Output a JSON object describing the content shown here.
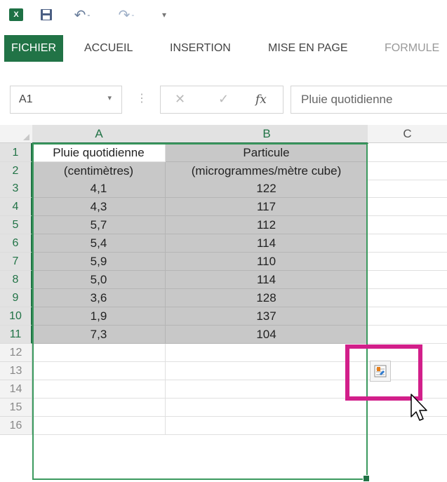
{
  "app": {
    "icon": "excel-icon"
  },
  "quick_access": {
    "save": "save-icon",
    "undo": "↶",
    "redo": "↷",
    "more": "▾",
    "dropdown_arrows": "-"
  },
  "ribbon": {
    "tabs": [
      {
        "label": "FICHIER",
        "active": true
      },
      {
        "label": "ACCUEIL"
      },
      {
        "label": "INSERTION"
      },
      {
        "label": "MISE EN PAGE"
      },
      {
        "label": "FORMULE"
      }
    ]
  },
  "formula_bar": {
    "name_box": "A1",
    "name_arrow": "▾",
    "separator": "⋮",
    "cancel": "✕",
    "enter": "✓",
    "fx": "fx",
    "value": "Pluie quotidienne"
  },
  "grid": {
    "columns": [
      "A",
      "B",
      "C"
    ],
    "rows": [
      {
        "num": "1",
        "a": "Pluie quotidienne",
        "b": "Particule"
      },
      {
        "num": "2",
        "a": "(centimètres)",
        "b": "(microgrammes/mètre cube)"
      },
      {
        "num": "3",
        "a": "4,1",
        "b": "122"
      },
      {
        "num": "4",
        "a": "4,3",
        "b": "117"
      },
      {
        "num": "5",
        "a": "5,7",
        "b": "112"
      },
      {
        "num": "6",
        "a": "5,4",
        "b": "114"
      },
      {
        "num": "7",
        "a": "5,9",
        "b": "110"
      },
      {
        "num": "8",
        "a": "5,0",
        "b": "114"
      },
      {
        "num": "9",
        "a": "3,6",
        "b": "128"
      },
      {
        "num": "10",
        "a": "1,9",
        "b": "137"
      },
      {
        "num": "11",
        "a": "7,3",
        "b": "104"
      },
      {
        "num": "12",
        "a": "",
        "b": ""
      },
      {
        "num": "13",
        "a": "",
        "b": ""
      },
      {
        "num": "14",
        "a": "",
        "b": ""
      },
      {
        "num": "15",
        "a": "",
        "b": ""
      },
      {
        "num": "16",
        "a": "",
        "b": ""
      }
    ]
  },
  "quick_analysis": {
    "icon": "quick-analysis-icon",
    "highlight_color": "#d21f8a"
  },
  "colors": {
    "accent": "#217346",
    "selection_fill": "#c8c8c8"
  }
}
